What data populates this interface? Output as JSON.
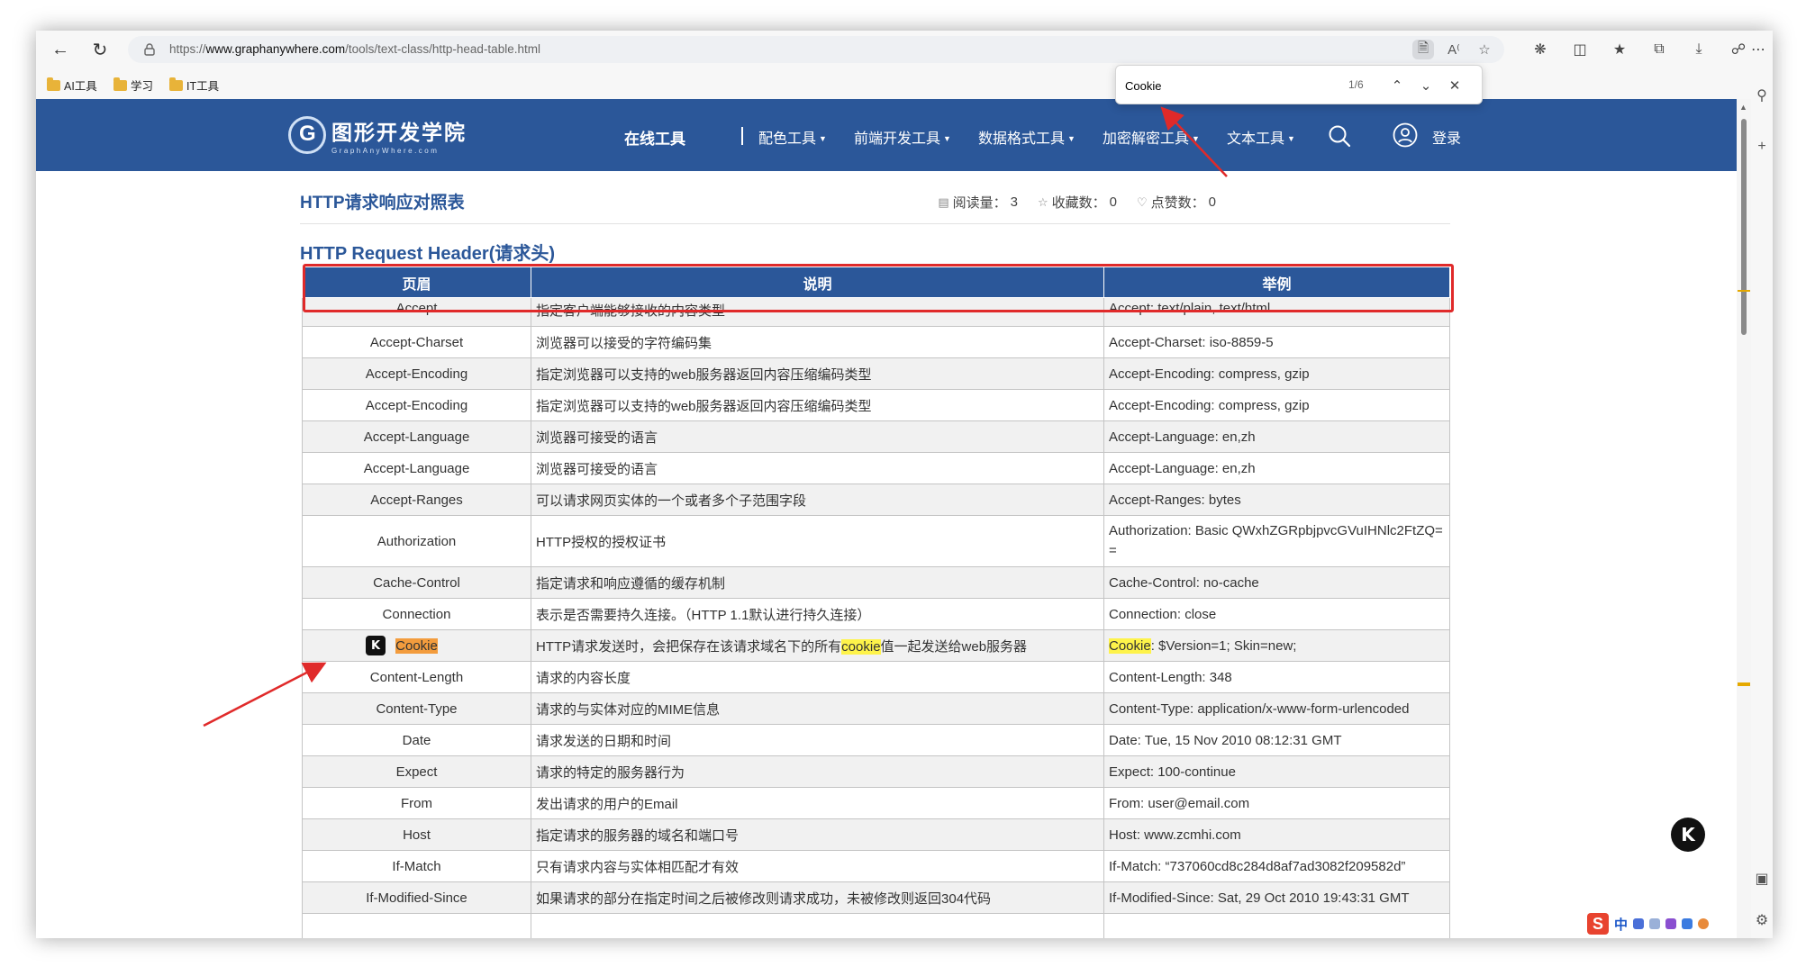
{
  "browser": {
    "url_prefix": "https://",
    "url_host": "www.graphanywhere.com",
    "url_path": "/tools/text-class/http-head-table.html"
  },
  "bookmarks": [
    {
      "label": "AI工具"
    },
    {
      "label": "学习"
    },
    {
      "label": "IT工具"
    }
  ],
  "find": {
    "query": "Cookie",
    "count": "1/6"
  },
  "site": {
    "name": "图形开发学院",
    "subtitle": "GraphAnyWhere.com",
    "nav": [
      {
        "label": "在线工具"
      },
      {
        "label": "配色工具"
      },
      {
        "label": "前端开发工具"
      },
      {
        "label": "数据格式工具"
      },
      {
        "label": "加密解密工具"
      },
      {
        "label": "文本工具"
      }
    ],
    "login_label": "登录"
  },
  "page": {
    "title": "HTTP请求响应对照表",
    "stats": {
      "reads_label": "阅读量：",
      "reads": "3",
      "favorites_label": "收藏数：",
      "favorites": "0",
      "likes_label": "点赞数：",
      "likes": "0"
    },
    "section_title": "HTTP Request Header(请求头)"
  },
  "table": {
    "headers": [
      "页眉",
      "说明",
      "举例"
    ],
    "rows": [
      {
        "name": "Accept",
        "desc": "指定客户端能够接收的内容类型",
        "example": "Accept: text/plain, text/html"
      },
      {
        "name": "Accept-Charset",
        "desc": "浏览器可以接受的字符编码集",
        "example": "Accept-Charset: iso-8859-5"
      },
      {
        "name": "Accept-Encoding",
        "desc": "指定浏览器可以支持的web服务器返回内容压缩编码类型",
        "example": "Accept-Encoding: compress, gzip"
      },
      {
        "name": "Accept-Encoding",
        "desc": "指定浏览器可以支持的web服务器返回内容压缩编码类型",
        "example": "Accept-Encoding: compress, gzip"
      },
      {
        "name": "Accept-Language",
        "desc": "浏览器可接受的语言",
        "example": "Accept-Language: en,zh"
      },
      {
        "name": "Accept-Language",
        "desc": "浏览器可接受的语言",
        "example": "Accept-Language: en,zh"
      },
      {
        "name": "Accept-Ranges",
        "desc": "可以请求网页实体的一个或者多个子范围字段",
        "example": "Accept-Ranges: bytes"
      },
      {
        "name": "Authorization",
        "desc": "HTTP授权的授权证书",
        "example": "Authorization: Basic QWxhZGRpbjpvcGVuIHNlc2FtZQ=="
      },
      {
        "name": "Cache-Control",
        "desc": "指定请求和响应遵循的缓存机制",
        "example": "Cache-Control: no-cache"
      },
      {
        "name": "Connection",
        "desc": "表示是否需要持久连接。（HTTP 1.1默认进行持久连接）",
        "example": "Connection: close"
      },
      {
        "name": "Cookie",
        "desc_before": "HTTP请求发送时，会把保存在该请求域名下的所有",
        "desc_hl": "cookie",
        "desc_after": "值一起发送给web服务器",
        "example_hl": "Cookie",
        "example_rest": ": $Version=1; Skin=new;"
      },
      {
        "name": "Content-Length",
        "desc": "请求的内容长度",
        "example": "Content-Length: 348"
      },
      {
        "name": "Content-Type",
        "desc": "请求的与实体对应的MIME信息",
        "example": "Content-Type: application/x-www-form-urlencoded"
      },
      {
        "name": "Date",
        "desc": "请求发送的日期和时间",
        "example": "Date: Tue, 15 Nov 2010 08:12:31 GMT"
      },
      {
        "name": "Expect",
        "desc": "请求的特定的服务器行为",
        "example": "Expect: 100-continue"
      },
      {
        "name": "From",
        "desc": "发出请求的用户的Email",
        "example": "From: user@email.com"
      },
      {
        "name": "Host",
        "desc": "指定请求的服务器的域名和端口号",
        "example": "Host: www.zcmhi.com"
      },
      {
        "name": "If-Match",
        "desc": "只有请求内容与实体相匹配才有效",
        "example": "If-Match: “737060cd8c284d8af7ad3082f209582d”"
      },
      {
        "name": "If-Modified-Since",
        "desc": "如果请求的部分在指定时间之后被修改则请求成功，未被修改则返回304代码",
        "example": "If-Modified-Since: Sat, 29 Oct 2010 19:43:31 GMT"
      }
    ]
  },
  "widgets": {
    "k_badge": "K",
    "ime_logo": "S",
    "ime_lang": "中"
  },
  "colors": {
    "brand_blue": "#2b5799",
    "highlight": "#fef34a",
    "highlight_current": "#f39c3d",
    "annotation_red": "#e02a2a"
  }
}
